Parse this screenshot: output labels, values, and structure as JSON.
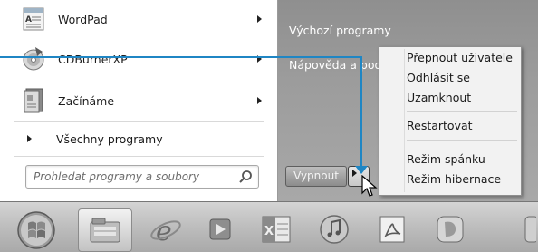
{
  "programs": [
    {
      "label": "WordPad",
      "icon": "wordpad-icon",
      "has_submenu": true
    },
    {
      "label": "CDBurnerXP",
      "icon": "cdburnerxp-icon",
      "has_submenu": true
    },
    {
      "label": "Začínáme",
      "icon": "getting-started-icon",
      "has_submenu": true
    }
  ],
  "all_programs_label": "Všechny programy",
  "search": {
    "placeholder": "Prohledat programy a soubory"
  },
  "right_panel": {
    "default_programs": "Výchozí programy",
    "help": "Nápověda a pod"
  },
  "shutdown": {
    "label": "Vypnout"
  },
  "submenu": {
    "items": [
      {
        "label": "Přepnout uživatele"
      },
      {
        "label": "Odhlásit se"
      },
      {
        "label": "Uzamknout"
      },
      {
        "label": "Restartovat"
      },
      {
        "label": "Režim spánku"
      },
      {
        "label": "Režim hibernace"
      }
    ]
  },
  "taskbar": {
    "items": [
      {
        "icon": "start-orb-icon"
      },
      {
        "icon": "file-explorer-icon",
        "active": true
      },
      {
        "icon": "internet-explorer-icon"
      },
      {
        "icon": "media-player-icon"
      },
      {
        "icon": "excel-icon"
      },
      {
        "icon": "itunes-icon"
      },
      {
        "icon": "acrobat-reader-icon"
      },
      {
        "icon": "app-icon"
      }
    ]
  },
  "colors": {
    "accent": "#1f86c4",
    "panel": "#9c9c9c"
  }
}
